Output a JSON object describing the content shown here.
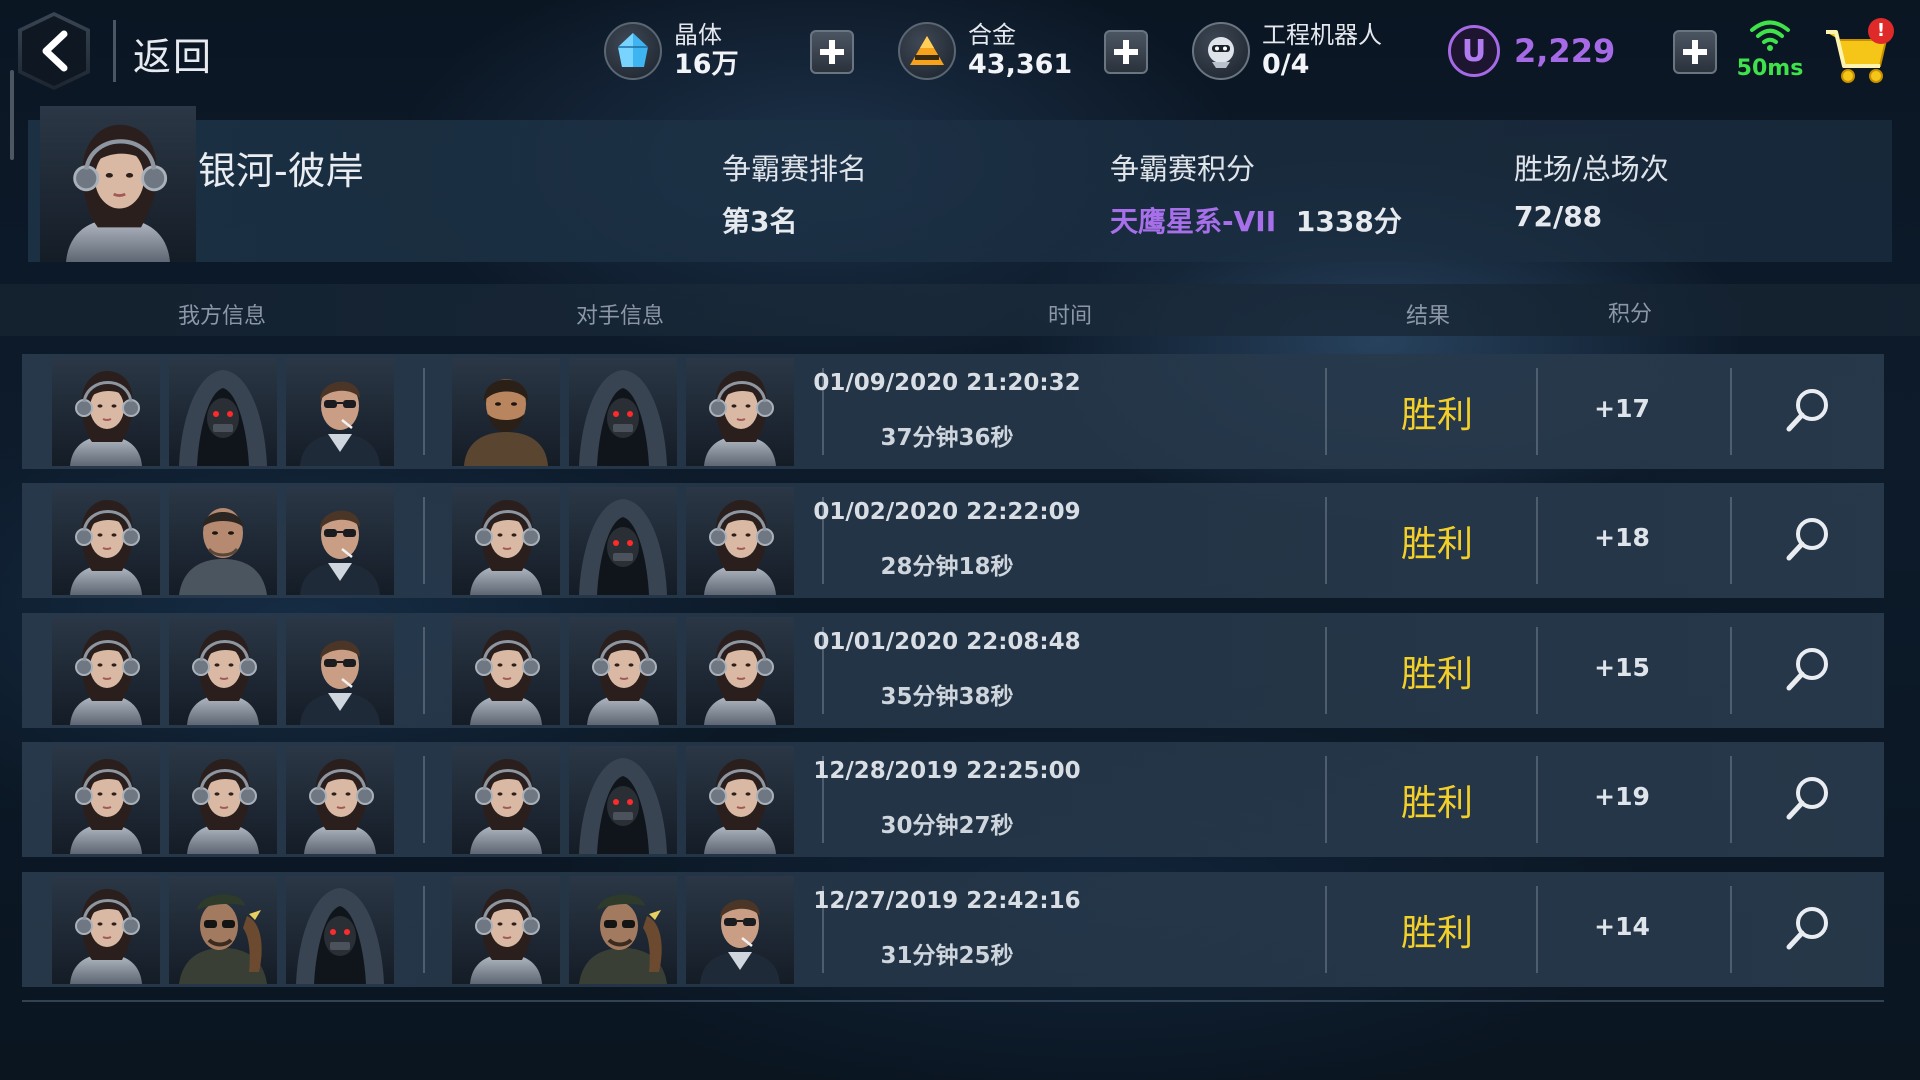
{
  "header": {
    "back_label": "返回",
    "crystal": {
      "label": "晶体",
      "value": "16万"
    },
    "alloy": {
      "label": "合金",
      "value": "43,361"
    },
    "robot": {
      "label": "工程机器人",
      "value": "0/4"
    },
    "ucoin": {
      "symbol": "U",
      "value": "2,229"
    },
    "ping": "50ms",
    "cart_badge": "!"
  },
  "profile": {
    "name": "银河-彼岸",
    "rank_label": "争霸赛排名",
    "rank_value": "第3名",
    "points_label": "争霸赛积分",
    "points_tier": "天鹰星系-VII",
    "points_value": "1338分",
    "record_label": "胜场/总场次",
    "record_value": "72/88"
  },
  "table": {
    "headers": {
      "mine": "我方信息",
      "opponent": "对手信息",
      "time": "时间",
      "result": "结果",
      "score": "积分"
    },
    "rows": [
      {
        "mine": [
          "girl",
          "hood",
          "glasses"
        ],
        "opp": [
          "bearded",
          "hood",
          "girl"
        ],
        "date": "01/09/2020 21:20:32",
        "duration": "37分钟36秒",
        "result": "胜利",
        "score": "+17"
      },
      {
        "mine": [
          "girl",
          "soldier",
          "glasses"
        ],
        "opp": [
          "girl",
          "hood",
          "girl"
        ],
        "date": "01/02/2020 22:22:09",
        "duration": "28分钟18秒",
        "result": "胜利",
        "score": "+18"
      },
      {
        "mine": [
          "girl",
          "girl",
          "glasses"
        ],
        "opp": [
          "girl",
          "girl",
          "girl"
        ],
        "date": "01/01/2020 22:08:48",
        "duration": "35分钟38秒",
        "result": "胜利",
        "score": "+15"
      },
      {
        "mine": [
          "girl",
          "girl",
          "girl"
        ],
        "opp": [
          "girl",
          "hood",
          "girl"
        ],
        "date": "12/28/2019 22:25:00",
        "duration": "30分钟27秒",
        "result": "胜利",
        "score": "+19"
      },
      {
        "mine": [
          "girl",
          "beret",
          "hood"
        ],
        "opp": [
          "girl",
          "beret",
          "glasses"
        ],
        "date": "12/27/2019 22:42:16",
        "duration": "31分钟25秒",
        "result": "胜利",
        "score": "+14"
      }
    ]
  },
  "colors": {
    "win": "#f3cf2a",
    "tier": "#a770ea",
    "ping": "#3fe24a",
    "ucoin": "#a66ae6"
  }
}
